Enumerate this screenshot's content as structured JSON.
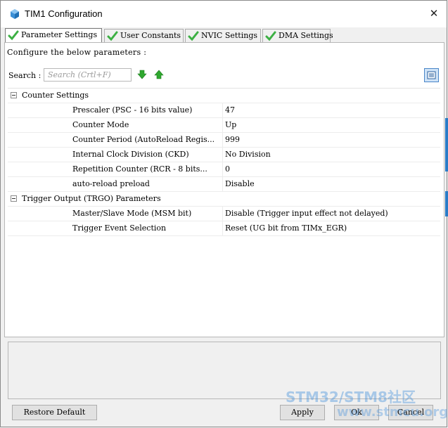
{
  "window": {
    "title": "TIM1 Configuration",
    "close_glyph": "✕"
  },
  "tabs": [
    {
      "label": "Parameter Settings",
      "active": true,
      "icon": "green-check-icon"
    },
    {
      "label": "User Constants",
      "active": false,
      "icon": "green-check-icon"
    },
    {
      "label": "NVIC Settings",
      "active": false,
      "icon": "green-check-icon"
    },
    {
      "label": "DMA Settings",
      "active": false,
      "icon": "green-check-icon"
    }
  ],
  "configure_label": "Configure the below parameters :",
  "search": {
    "label": "Search :",
    "placeholder": "Search (Crtl+F)"
  },
  "sections": [
    {
      "title": "Counter Settings",
      "rows": [
        {
          "name": "Prescaler (PSC - 16 bits value)",
          "value": "47"
        },
        {
          "name": "Counter Mode",
          "value": "Up"
        },
        {
          "name": "Counter Period (AutoReload Regis...",
          "value": "999"
        },
        {
          "name": "Internal Clock Division (CKD)",
          "value": "No Division"
        },
        {
          "name": "Repetition Counter (RCR - 8 bits...",
          "value": "0"
        },
        {
          "name": "auto-reload preload",
          "value": "Disable"
        }
      ]
    },
    {
      "title": "Trigger Output (TRGO) Parameters",
      "rows": [
        {
          "name": "Master/Slave Mode (MSM bit)",
          "value": "Disable (Trigger input effect not delayed)"
        },
        {
          "name": "Trigger Event Selection",
          "value": "Reset (UG bit from TIMx_EGR)"
        }
      ]
    }
  ],
  "buttons": {
    "restore": "Restore Default",
    "apply": "Apply",
    "ok": "Ok",
    "cancel": "Cancel"
  },
  "watermark": {
    "text": "STM32/STM8社区",
    "url": "www.stmcu.org.cn"
  },
  "colors": {
    "check_green": "#3cb043",
    "arrow_green": "#2fa82f",
    "accent_blue": "#2a7cc7"
  }
}
